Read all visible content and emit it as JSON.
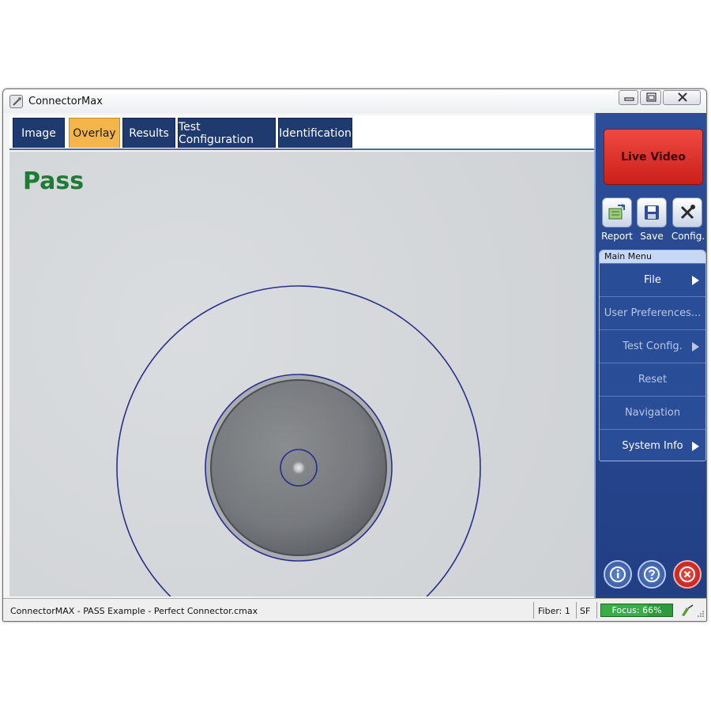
{
  "window": {
    "title": "ConnectorMax"
  },
  "tabs": [
    {
      "label": "Image",
      "active": false
    },
    {
      "label": "Overlay",
      "active": true
    },
    {
      "label": "Results",
      "active": false
    },
    {
      "label": "Test Configuration",
      "active": false
    },
    {
      "label": "Identification",
      "active": false
    }
  ],
  "result": {
    "label": "Pass",
    "color": "#1e7a35"
  },
  "sidebar": {
    "live_video_label": "Live Video",
    "tools": [
      {
        "label": "Report",
        "icon": "report-icon"
      },
      {
        "label": "Save",
        "icon": "save-icon"
      },
      {
        "label": "Config.",
        "icon": "config-icon"
      }
    ],
    "main_menu": {
      "header": "Main Menu",
      "items": [
        {
          "label": "File",
          "has_submenu": true,
          "enabled": true
        },
        {
          "label": "User Preferences...",
          "has_submenu": false,
          "enabled": false
        },
        {
          "label": "Test Config.",
          "has_submenu": true,
          "enabled": false
        },
        {
          "label": "Reset",
          "has_submenu": false,
          "enabled": false
        },
        {
          "label": "Navigation",
          "has_submenu": false,
          "enabled": false
        },
        {
          "label": "System Info",
          "has_submenu": true,
          "enabled": true
        }
      ]
    },
    "bottom_buttons": [
      {
        "icon": "info-icon"
      },
      {
        "icon": "help-icon"
      },
      {
        "icon": "exit-icon"
      }
    ]
  },
  "status": {
    "file": "ConnectorMAX - PASS Example - Perfect Connector.cmax",
    "fiber": "Fiber: 1",
    "mode": "SF",
    "focus": "Focus: 66%",
    "focus_value": 0.66
  },
  "colors": {
    "tab_active": "#f4b64a",
    "tab_inactive": "#1f3a6e",
    "sidebar": "#2c4f99",
    "live_video": "#dd2e27",
    "overlay_ring": "#2a2f8a",
    "focus_bar": "#2e9a3c"
  }
}
